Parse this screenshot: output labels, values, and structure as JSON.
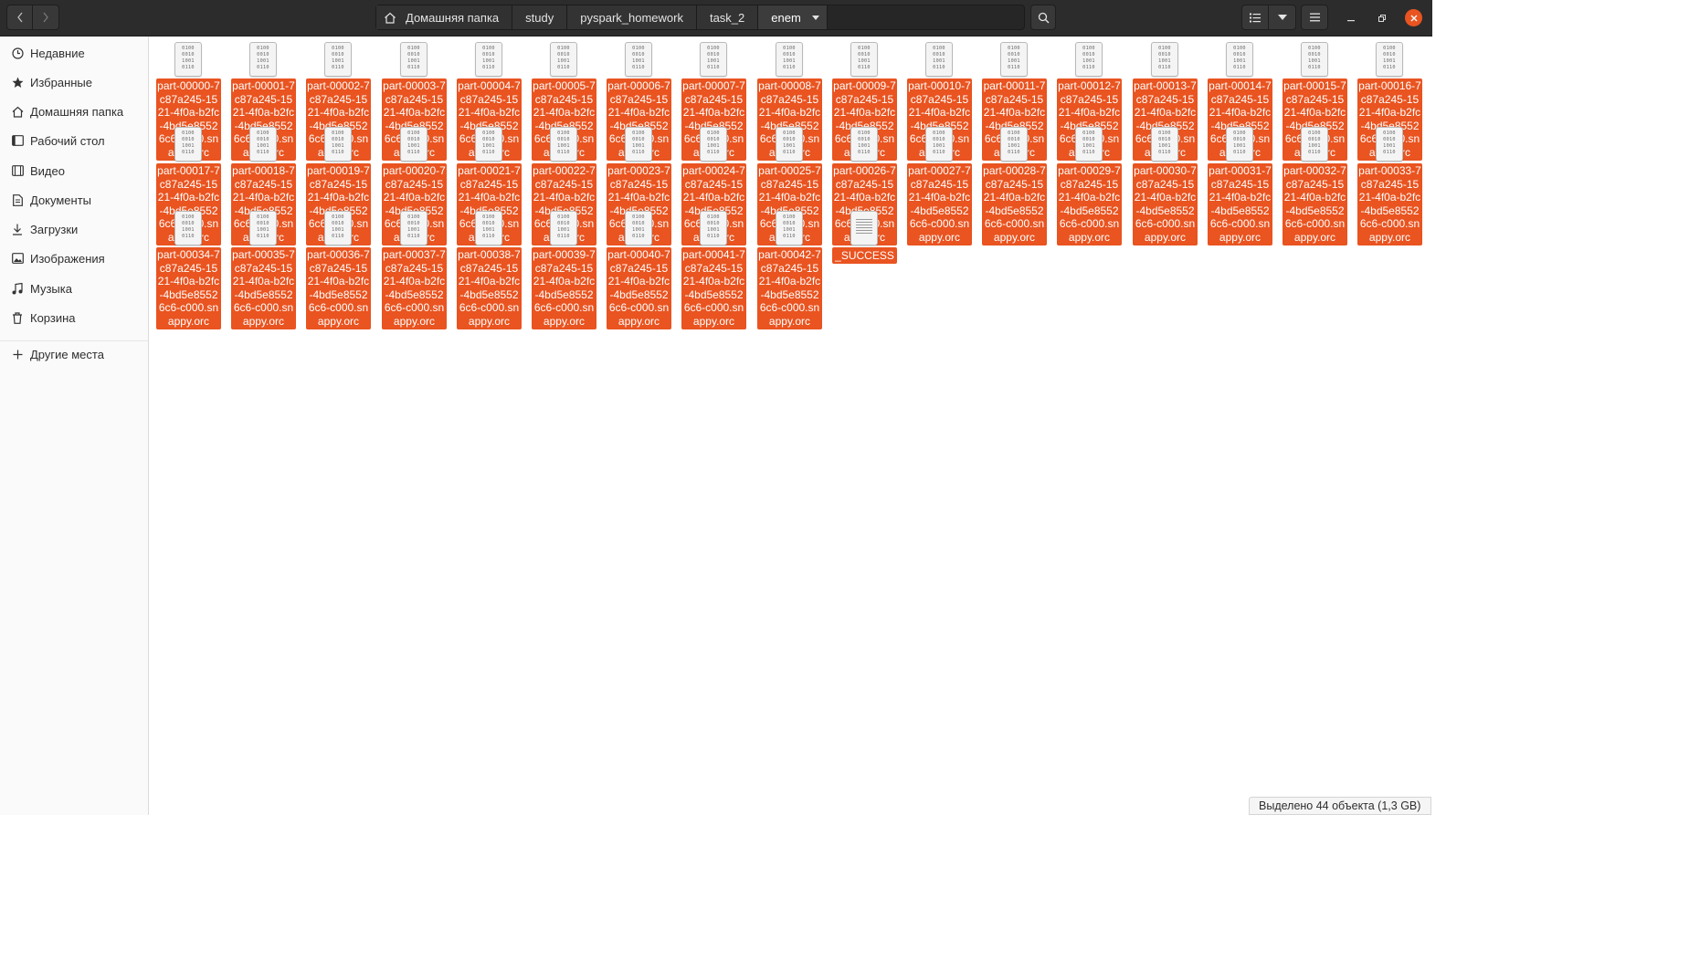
{
  "header": {
    "breadcrumbs": [
      "Домашняя папка",
      "study",
      "pyspark_homework",
      "task_2",
      "enem"
    ]
  },
  "sidebar": {
    "items": [
      {
        "label": "Недавние",
        "icon": "clock-icon"
      },
      {
        "label": "Избранные",
        "icon": "star-icon"
      },
      {
        "label": "Домашняя папка",
        "icon": "home-icon"
      },
      {
        "label": "Рабочий стол",
        "icon": "desktop-icon"
      },
      {
        "label": "Видео",
        "icon": "video-icon"
      },
      {
        "label": "Документы",
        "icon": "document-icon"
      },
      {
        "label": "Загрузки",
        "icon": "download-icon"
      },
      {
        "label": "Изображения",
        "icon": "image-icon"
      },
      {
        "label": "Музыка",
        "icon": "music-icon"
      },
      {
        "label": "Корзина",
        "icon": "trash-icon"
      }
    ],
    "other": {
      "label": "Другие места",
      "icon": "plus-icon"
    }
  },
  "files": [
    {
      "name": "part-00000-7c87a245-1521-4f0a-b2fc-4bd5e85526c6-c000.snappy.orc",
      "icon": "binary-file-icon"
    },
    {
      "name": "part-00001-7c87a245-1521-4f0a-b2fc-4bd5e85526c6-c000.snappy.orc",
      "icon": "binary-file-icon"
    },
    {
      "name": "part-00002-7c87a245-1521-4f0a-b2fc-4bd5e85526c6-c000.snappy.orc",
      "icon": "binary-file-icon"
    },
    {
      "name": "part-00003-7c87a245-1521-4f0a-b2fc-4bd5e85526c6-c000.snappy.orc",
      "icon": "binary-file-icon"
    },
    {
      "name": "part-00004-7c87a245-1521-4f0a-b2fc-4bd5e85526c6-c000.snappy.orc",
      "icon": "binary-file-icon"
    },
    {
      "name": "part-00005-7c87a245-1521-4f0a-b2fc-4bd5e85526c6-c000.snappy.orc",
      "icon": "binary-file-icon"
    },
    {
      "name": "part-00006-7c87a245-1521-4f0a-b2fc-4bd5e85526c6-c000.snappy.orc",
      "icon": "binary-file-icon"
    },
    {
      "name": "part-00007-7c87a245-1521-4f0a-b2fc-4bd5e85526c6-c000.snappy.orc",
      "icon": "binary-file-icon"
    },
    {
      "name": "part-00008-7c87a245-1521-4f0a-b2fc-4bd5e85526c6-c000.snappy.orc",
      "icon": "binary-file-icon"
    },
    {
      "name": "part-00009-7c87a245-1521-4f0a-b2fc-4bd5e85526c6-c000.snappy.orc",
      "icon": "binary-file-icon"
    },
    {
      "name": "part-00010-7c87a245-1521-4f0a-b2fc-4bd5e85526c6-c000.snappy.orc",
      "icon": "binary-file-icon"
    },
    {
      "name": "part-00011-7c87a245-1521-4f0a-b2fc-4bd5e85526c6-c000.snappy.orc",
      "icon": "binary-file-icon"
    },
    {
      "name": "part-00012-7c87a245-1521-4f0a-b2fc-4bd5e85526c6-c000.snappy.orc",
      "icon": "binary-file-icon"
    },
    {
      "name": "part-00013-7c87a245-1521-4f0a-b2fc-4bd5e85526c6-c000.snappy.orc",
      "icon": "binary-file-icon"
    },
    {
      "name": "part-00014-7c87a245-1521-4f0a-b2fc-4bd5e85526c6-c000.snappy.orc",
      "icon": "binary-file-icon"
    },
    {
      "name": "part-00015-7c87a245-1521-4f0a-b2fc-4bd5e85526c6-c000.snappy.orc",
      "icon": "binary-file-icon"
    },
    {
      "name": "part-00016-7c87a245-1521-4f0a-b2fc-4bd5e85526c6-c000.snappy.orc",
      "icon": "binary-file-icon"
    },
    {
      "name": "part-00017-7c87a245-1521-4f0a-b2fc-4bd5e85526c6-c000.snappy.orc",
      "icon": "binary-file-icon"
    },
    {
      "name": "part-00018-7c87a245-1521-4f0a-b2fc-4bd5e85526c6-c000.snappy.orc",
      "icon": "binary-file-icon"
    },
    {
      "name": "part-00019-7c87a245-1521-4f0a-b2fc-4bd5e85526c6-c000.snappy.orc",
      "icon": "binary-file-icon"
    },
    {
      "name": "part-00020-7c87a245-1521-4f0a-b2fc-4bd5e85526c6-c000.snappy.orc",
      "icon": "binary-file-icon"
    },
    {
      "name": "part-00021-7c87a245-1521-4f0a-b2fc-4bd5e85526c6-c000.snappy.orc",
      "icon": "binary-file-icon"
    },
    {
      "name": "part-00022-7c87a245-1521-4f0a-b2fc-4bd5e85526c6-c000.snappy.orc",
      "icon": "binary-file-icon"
    },
    {
      "name": "part-00023-7c87a245-1521-4f0a-b2fc-4bd5e85526c6-c000.snappy.orc",
      "icon": "binary-file-icon"
    },
    {
      "name": "part-00024-7c87a245-1521-4f0a-b2fc-4bd5e85526c6-c000.snappy.orc",
      "icon": "binary-file-icon"
    },
    {
      "name": "part-00025-7c87a245-1521-4f0a-b2fc-4bd5e85526c6-c000.snappy.orc",
      "icon": "binary-file-icon"
    },
    {
      "name": "part-00026-7c87a245-1521-4f0a-b2fc-4bd5e85526c6-c000.snappy.orc",
      "icon": "binary-file-icon"
    },
    {
      "name": "part-00027-7c87a245-1521-4f0a-b2fc-4bd5e85526c6-c000.snappy.orc",
      "icon": "binary-file-icon"
    },
    {
      "name": "part-00028-7c87a245-1521-4f0a-b2fc-4bd5e85526c6-c000.snappy.orc",
      "icon": "binary-file-icon"
    },
    {
      "name": "part-00029-7c87a245-1521-4f0a-b2fc-4bd5e85526c6-c000.snappy.orc",
      "icon": "binary-file-icon"
    },
    {
      "name": "part-00030-7c87a245-1521-4f0a-b2fc-4bd5e85526c6-c000.snappy.orc",
      "icon": "binary-file-icon"
    },
    {
      "name": "part-00031-7c87a245-1521-4f0a-b2fc-4bd5e85526c6-c000.snappy.orc",
      "icon": "binary-file-icon"
    },
    {
      "name": "part-00032-7c87a245-1521-4f0a-b2fc-4bd5e85526c6-c000.snappy.orc",
      "icon": "binary-file-icon"
    },
    {
      "name": "part-00033-7c87a245-1521-4f0a-b2fc-4bd5e85526c6-c000.snappy.orc",
      "icon": "binary-file-icon"
    },
    {
      "name": "part-00034-7c87a245-1521-4f0a-b2fc-4bd5e85526c6-c000.snappy.orc",
      "icon": "binary-file-icon"
    },
    {
      "name": "part-00035-7c87a245-1521-4f0a-b2fc-4bd5e85526c6-c000.snappy.orc",
      "icon": "binary-file-icon"
    },
    {
      "name": "part-00036-7c87a245-1521-4f0a-b2fc-4bd5e85526c6-c000.snappy.orc",
      "icon": "binary-file-icon"
    },
    {
      "name": "part-00037-7c87a245-1521-4f0a-b2fc-4bd5e85526c6-c000.snappy.orc",
      "icon": "binary-file-icon"
    },
    {
      "name": "part-00038-7c87a245-1521-4f0a-b2fc-4bd5e85526c6-c000.snappy.orc",
      "icon": "binary-file-icon"
    },
    {
      "name": "part-00039-7c87a245-1521-4f0a-b2fc-4bd5e85526c6-c000.snappy.orc",
      "icon": "binary-file-icon"
    },
    {
      "name": "part-00040-7c87a245-1521-4f0a-b2fc-4bd5e85526c6-c000.snappy.orc",
      "icon": "binary-file-icon"
    },
    {
      "name": "part-00041-7c87a245-1521-4f0a-b2fc-4bd5e85526c6-c000.snappy.orc",
      "icon": "binary-file-icon"
    },
    {
      "name": "part-00042-7c87a245-1521-4f0a-b2fc-4bd5e85526c6-c000.snappy.orc",
      "icon": "binary-file-icon"
    },
    {
      "name": "_SUCCESS",
      "icon": "text-file-icon"
    }
  ],
  "binary_icon_lines": [
    "0100",
    "0010",
    "1001",
    "0110"
  ],
  "status": {
    "selection": "Выделено 44 объекта (1,3 GB)"
  },
  "colors": {
    "selection": "#e95420",
    "header": "#2c2c2c",
    "close_button": "#e95420"
  }
}
